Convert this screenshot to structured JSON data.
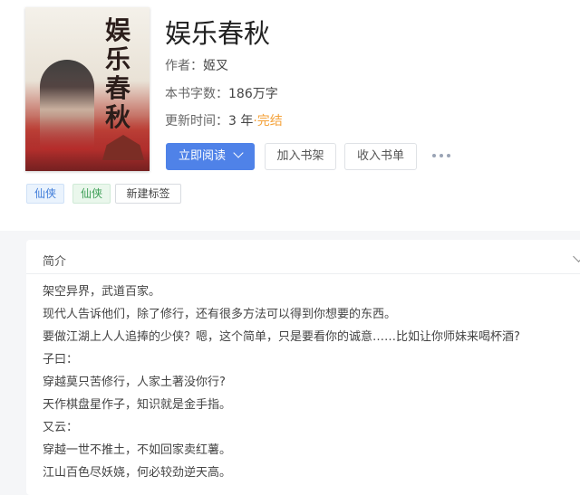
{
  "book": {
    "title": "娱乐春秋",
    "cover_title": "娱乐春秋",
    "author_label": "作者：",
    "author": "姬叉",
    "word_count_label": "本书字数：",
    "word_count": "186万字",
    "update_label": "更新时间：",
    "update_time": "3 年",
    "status": "·完结"
  },
  "actions": {
    "read_label": "立即阅读",
    "add_shelf_label": "加入书架",
    "add_list_label": "收入书单"
  },
  "tags": [
    "仙侠",
    "仙侠",
    "新建标签"
  ],
  "intro": {
    "header": "简介",
    "lines": [
      "架空异界，武道百家。",
      "现代人告诉他们，除了修行，还有很多方法可以得到你想要的东西。",
      "要做江湖上人人追捧的少侠？嗯，这个简单，只是要看你的诚意……比如让你师妹来喝杯酒?",
      "子曰：",
      "穿越莫只苦修行，人家土著没你行?",
      "天作棋盘星作子，知识就是金手指。",
      "又云：",
      "穿越一世不推土，不如回家卖红薯。",
      "江山百色尽妖娆，何必较劲逆天高。"
    ]
  },
  "colors": {
    "primary": "#4f82e8",
    "status": "#f4a23a",
    "tag_blue": "#3d7bd9",
    "tag_green": "#3c9e55"
  }
}
